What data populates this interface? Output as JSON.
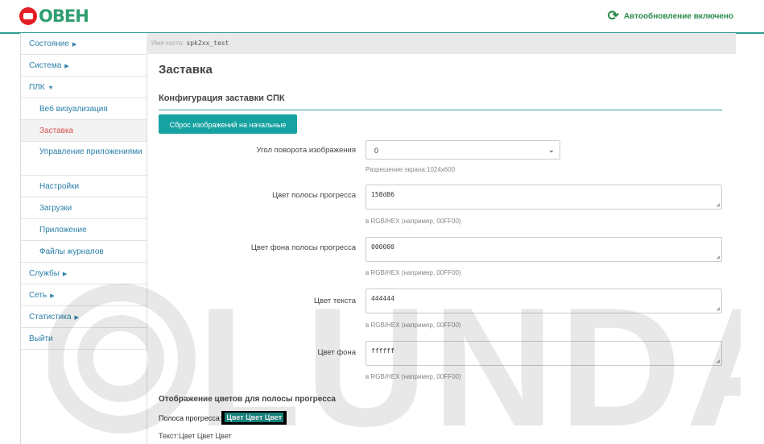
{
  "header": {
    "logo_text": "ОВЕН",
    "autorefresh_label": "Автообновление включено"
  },
  "sidebar": {
    "items": [
      {
        "label": "Состояние",
        "arrow": "▶"
      },
      {
        "label": "Система",
        "arrow": "▶"
      },
      {
        "label": "ПЛК",
        "arrow": "▼"
      },
      {
        "label": "Веб визуализация"
      },
      {
        "label": "Заставка"
      },
      {
        "label": "Управление приложениями"
      },
      {
        "label": "Настройки"
      },
      {
        "label": "Загрузки"
      },
      {
        "label": "Приложение"
      },
      {
        "label": "Файлы журналов"
      },
      {
        "label": "Службы",
        "arrow": "▶"
      },
      {
        "label": "Сеть",
        "arrow": "▶"
      },
      {
        "label": "Статистика",
        "arrow": "▶"
      },
      {
        "label": "Выйти"
      }
    ]
  },
  "hostbar": {
    "label": "Имя хоста:",
    "value": "spk2xx_test"
  },
  "main": {
    "title": "Заставка",
    "section_title": "Конфигурация заставки СПК",
    "reset_button": "Сброс изображений на начальные",
    "rotation": {
      "label": "Угол поворота изображения",
      "value": "0",
      "hint": "Разрешение экрана:1024x600"
    },
    "fields": [
      {
        "label": "Цвет полосы прогресса",
        "value": "158d86",
        "hint": "в RGB/HEX (например, 00FF00)"
      },
      {
        "label": "Цвет фона полосы прогресса",
        "value": "000000",
        "hint": "в RGB/HEX (например, 00FF00)"
      },
      {
        "label": "Цвет текста",
        "value": "444444",
        "hint": "в RGB/HEX (например, 00FF00)"
      },
      {
        "label": "Цвет фона",
        "value": "ffffff",
        "hint": "в RGB/HEX (например, 00FF00)"
      }
    ],
    "preview_title": "Отображение цветов для полосы прогресса",
    "progress_label": "Полоса прогресса:",
    "progress_sample": "Цвет Цвет Цвет",
    "text_line": "Текст:Цвет Цвет Цвет"
  },
  "watermark_text": "LUNDA",
  "colors": {
    "accent": "#17a2a2",
    "link": "#2a7fa8",
    "active": "#d9534f",
    "progress": "#158d86"
  }
}
